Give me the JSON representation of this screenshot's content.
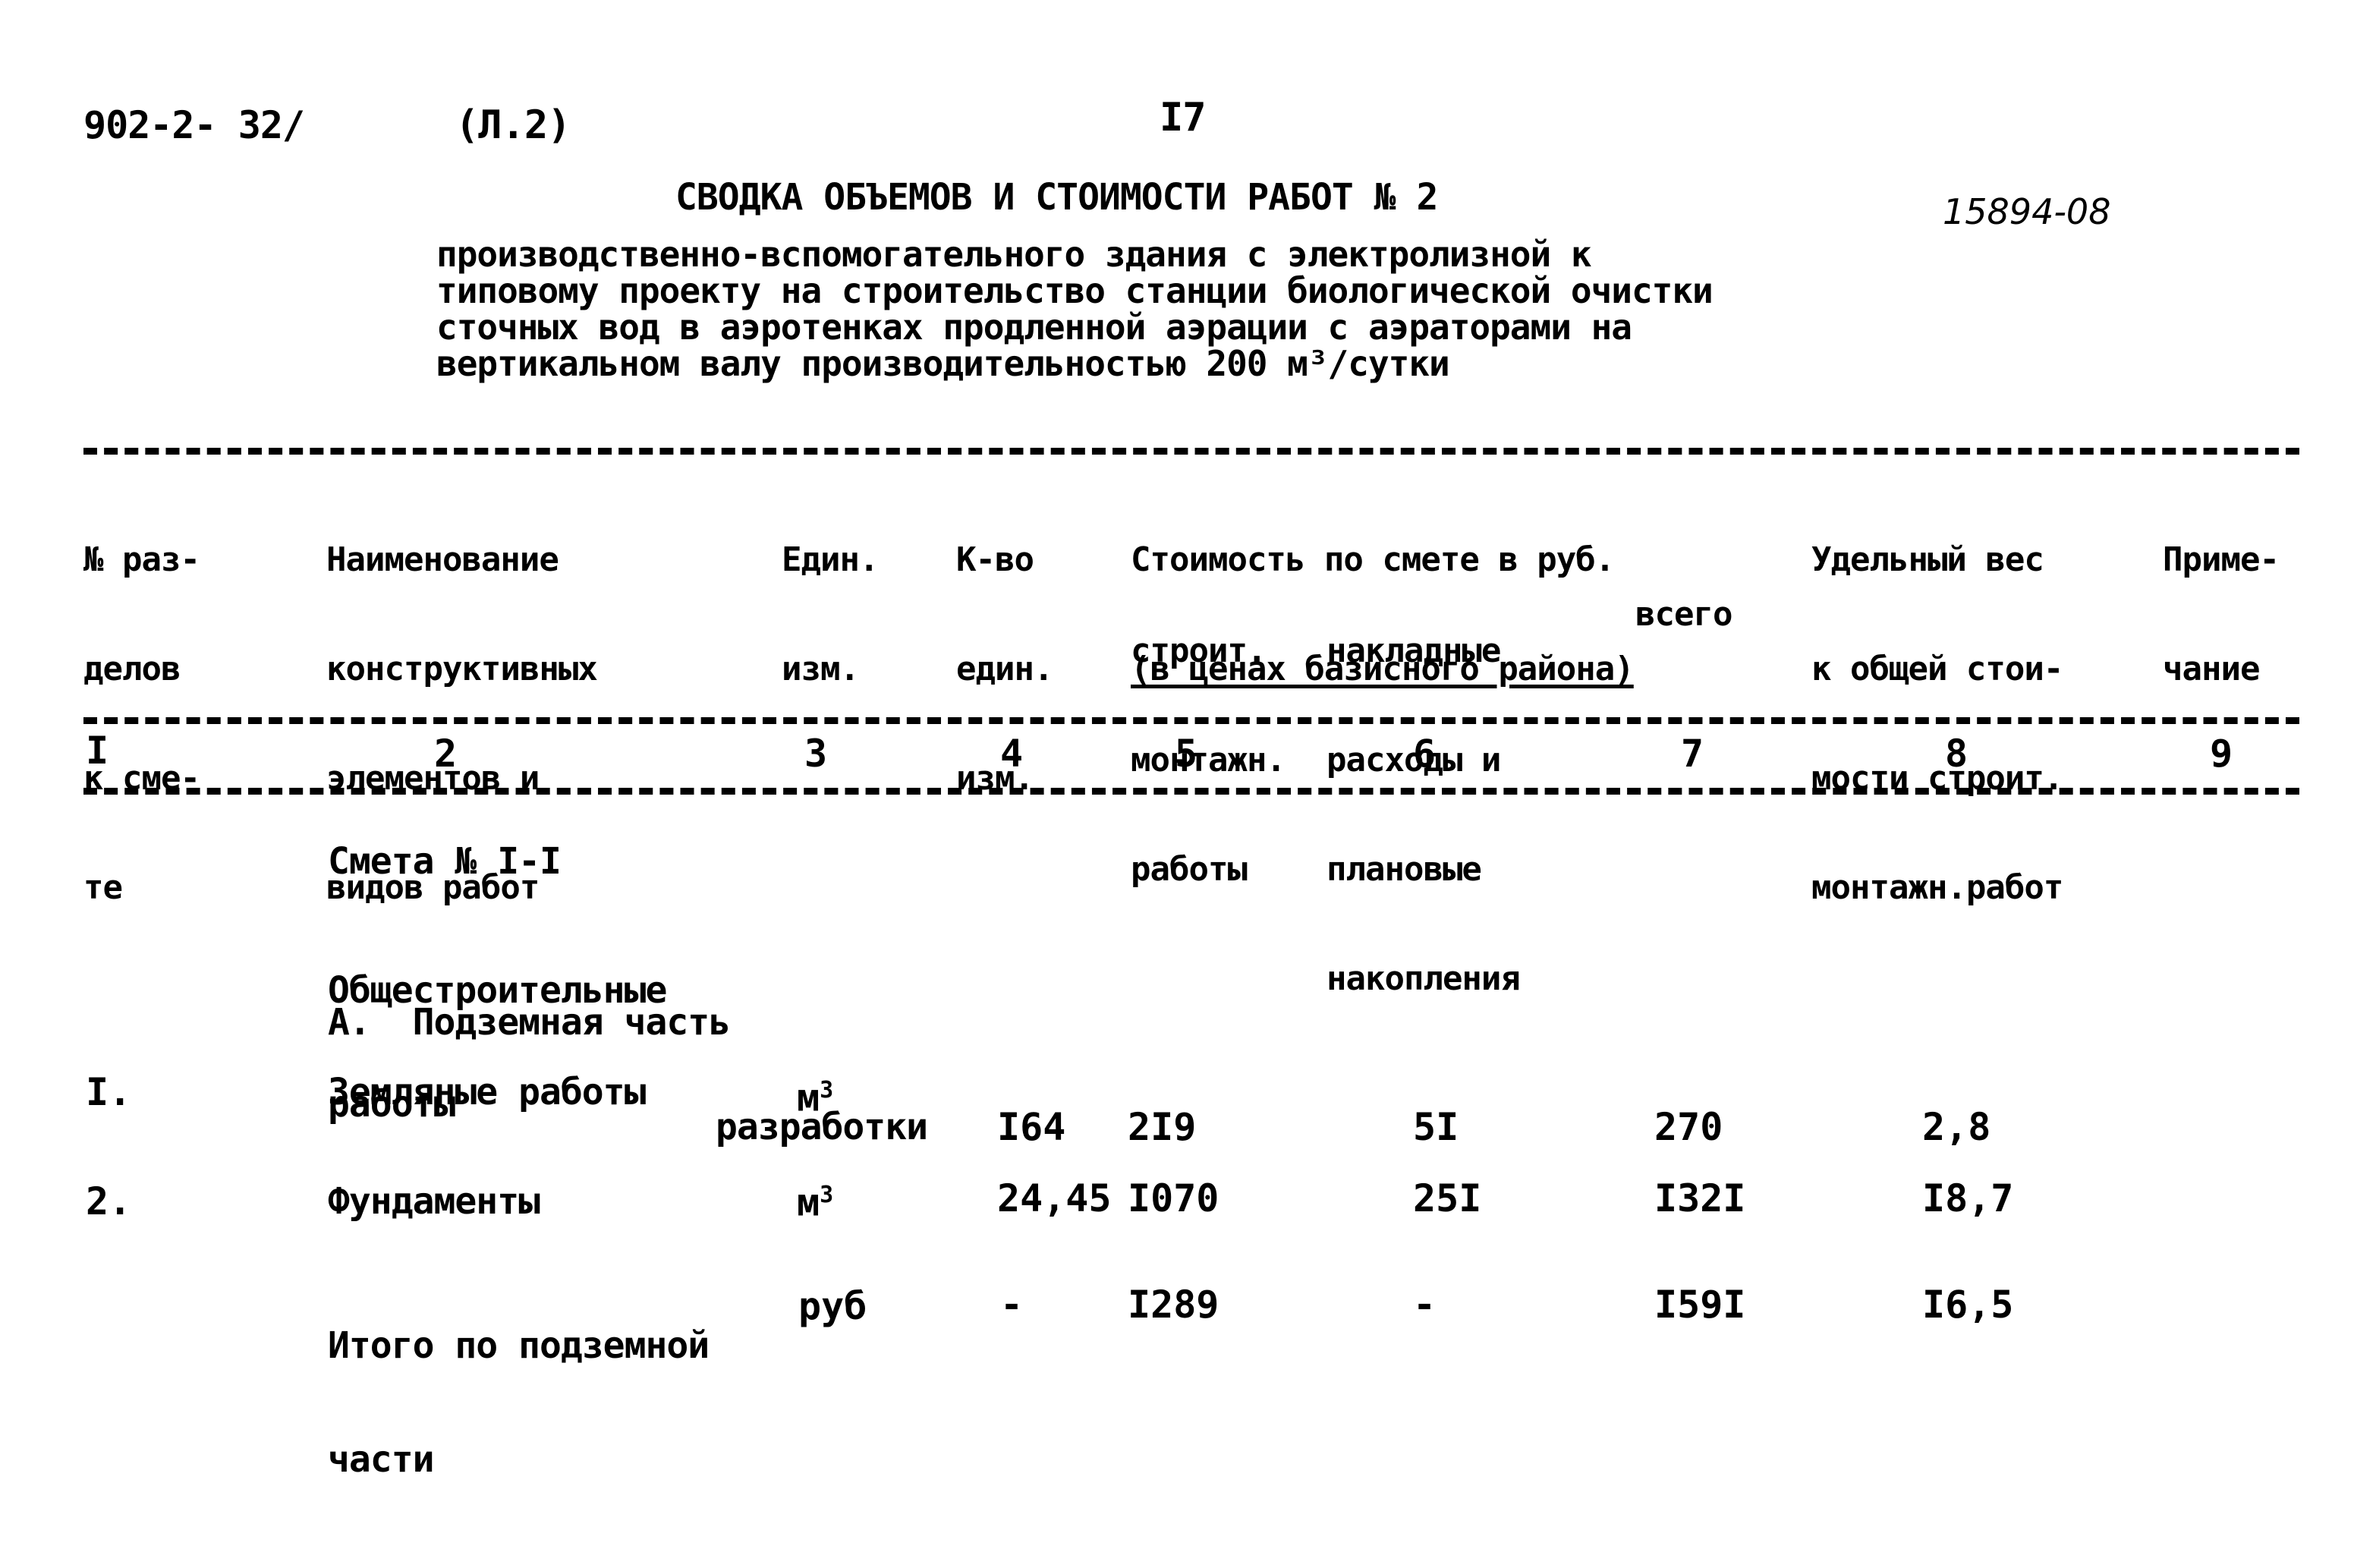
{
  "header": {
    "doc_code": "902-2- 32/",
    "sheet": "(Л.2)",
    "page_number": "I7",
    "handwritten_number": "15894-08",
    "title": "СВОДКА ОБЪЕМОВ И СТОИМОСТИ РАБОТ № 2",
    "subtitle_lines": [
      "производственно-вспомогательного здания с электролизной к",
      "типовому проекту на строительство станции биологической очистки",
      "сточных вод в аэротенках продленной аэрации с аэраторами на",
      "вертикальном валу производительностью 200 м³/сутки"
    ]
  },
  "table": {
    "columns": [
      {
        "lines": [
          "№ раз-",
          "делов",
          "к сме-",
          "те"
        ]
      },
      {
        "lines": [
          "Наименование",
          "конструктивных",
          "элементов и",
          "видов работ"
        ]
      },
      {
        "lines": [
          "Един.",
          "изм."
        ]
      },
      {
        "lines": [
          "К-во",
          "един.",
          "изм."
        ]
      },
      {
        "group_lines": [
          "Стоимость по смете в руб.",
          "(в ценах базисного района)"
        ],
        "sub": [
          {
            "lines": [
              "строит.",
              "монтажн.",
              "работы"
            ]
          },
          {
            "lines": [
              "накладные",
              "расходы и",
              "плановые",
              "накопления"
            ]
          },
          {
            "lines": [
              "всего"
            ]
          }
        ]
      },
      {
        "lines": [
          "Удельный вес",
          "к общей стои-",
          "мости строит.",
          "монтажн.работ"
        ]
      },
      {
        "lines": [
          "Приме-",
          "чание"
        ]
      }
    ],
    "column_numbers": [
      "I",
      "2",
      "3",
      "4",
      "5",
      "6",
      "7",
      "8",
      "9"
    ],
    "sections": {
      "estimate": "Смета № I-I",
      "category_lines": [
        "Общестроительные",
        "работы"
      ],
      "part": "А.  Подземная часть"
    },
    "rows": [
      {
        "no": "I.",
        "name": "Земляные работы",
        "unit_main": "м",
        "unit_sup": "3",
        "unit_extra": "разработки",
        "qty": "I64",
        "construction": "2I9",
        "overhead": "5I",
        "total": "270",
        "share": "2,8",
        "note": ""
      },
      {
        "no": "2.",
        "name": "Фундаменты",
        "unit_main": "м",
        "unit_sup": "3",
        "unit_extra": "",
        "qty": "24,45",
        "construction": "I070",
        "overhead": "25I",
        "total": "I32I",
        "share": "I8,7",
        "note": ""
      }
    ],
    "total_row": {
      "name_lines": [
        "Итого по подземной",
        "части"
      ],
      "unit": "руб",
      "qty": "-",
      "construction": "I289",
      "overhead": "-",
      "total": "I59I",
      "share": "I6,5"
    }
  }
}
